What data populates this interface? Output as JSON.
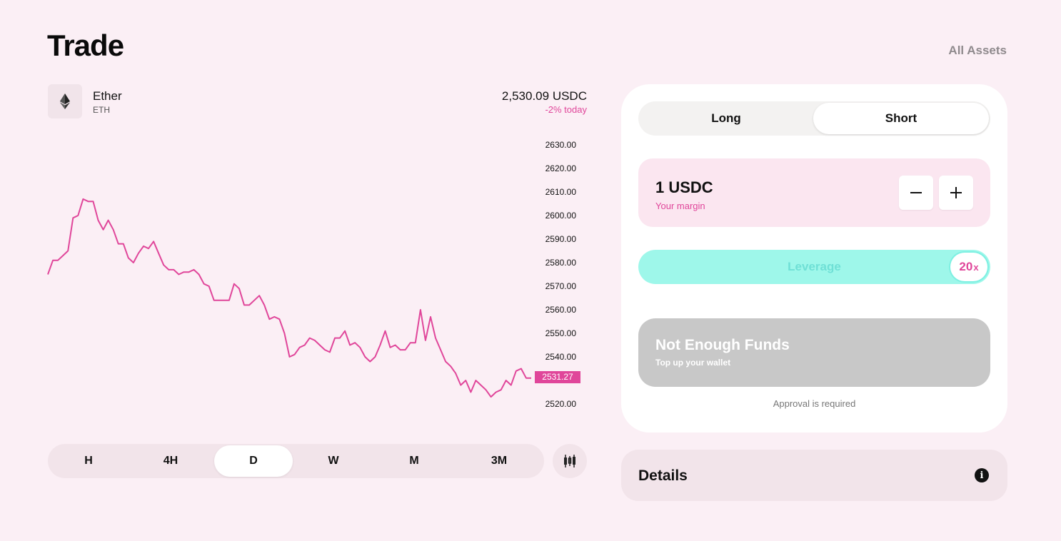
{
  "page": {
    "title": "Trade",
    "all_assets_link": "All Assets"
  },
  "asset": {
    "name": "Ether",
    "symbol": "ETH",
    "icon": "ethereum-icon",
    "price": "2,530.09 USDC",
    "change": "-2% today"
  },
  "colors": {
    "background": "#fbeff5",
    "accent_pink": "#e0469a",
    "leverage_teal": "#9ef7ea",
    "disabled_gray": "#c8c8c8"
  },
  "chart_data": {
    "type": "line",
    "series": [
      {
        "values": [
          2575,
          2581,
          2581,
          2583,
          2585,
          2599,
          2600,
          2607,
          2606,
          2606,
          2598,
          2594,
          2598,
          2594,
          2588,
          2588,
          2582,
          2580,
          2584,
          2587,
          2586,
          2589,
          2584,
          2579,
          2577,
          2577,
          2575,
          2576,
          2576,
          2577,
          2575,
          2571,
          2570,
          2564,
          2564,
          2564,
          2564,
          2571,
          2569,
          2562,
          2562,
          2564,
          2566,
          2562,
          2556,
          2557,
          2556,
          2550,
          2540,
          2541,
          2544,
          2545,
          2548,
          2547,
          2545,
          2543,
          2542,
          2548,
          2548,
          2551,
          2545,
          2546,
          2544,
          2540,
          2538,
          2540,
          2545,
          2551,
          2544,
          2545,
          2543,
          2543,
          2546,
          2546,
          2560,
          2547,
          2557,
          2548,
          2543,
          2538,
          2536,
          2533,
          2528,
          2530,
          2525,
          2530,
          2528,
          2526,
          2523,
          2525,
          2526,
          2530,
          2528,
          2534,
          2535,
          2531,
          2531
        ]
      }
    ],
    "ylim": [
      2520,
      2630
    ],
    "y_ticks": [
      "2630.00",
      "2620.00",
      "2610.00",
      "2600.00",
      "2590.00",
      "2580.00",
      "2570.00",
      "2560.00",
      "2550.00",
      "2540.00",
      "2520.00"
    ],
    "current_price_label": "2531.27",
    "line_color": "#e0469a",
    "grid": false
  },
  "timeframes": {
    "items": [
      "H",
      "4H",
      "D",
      "W",
      "M",
      "3M"
    ],
    "active": "D"
  },
  "candle_toggle_icon": "candlestick-icon",
  "trade": {
    "sides": [
      "Long",
      "Short"
    ],
    "active_side": "Short",
    "margin": {
      "value": "1 USDC",
      "label": "Your margin"
    },
    "minus_icon": "minus-icon",
    "plus_icon": "plus-icon",
    "leverage": {
      "label": "Leverage",
      "value": "20",
      "unit": "x"
    },
    "submit": {
      "title": "Not Enough Funds",
      "subtitle": "Top up your wallet"
    },
    "approval_note": "Approval is required"
  },
  "details": {
    "title": "Details",
    "icon": "info-icon"
  }
}
